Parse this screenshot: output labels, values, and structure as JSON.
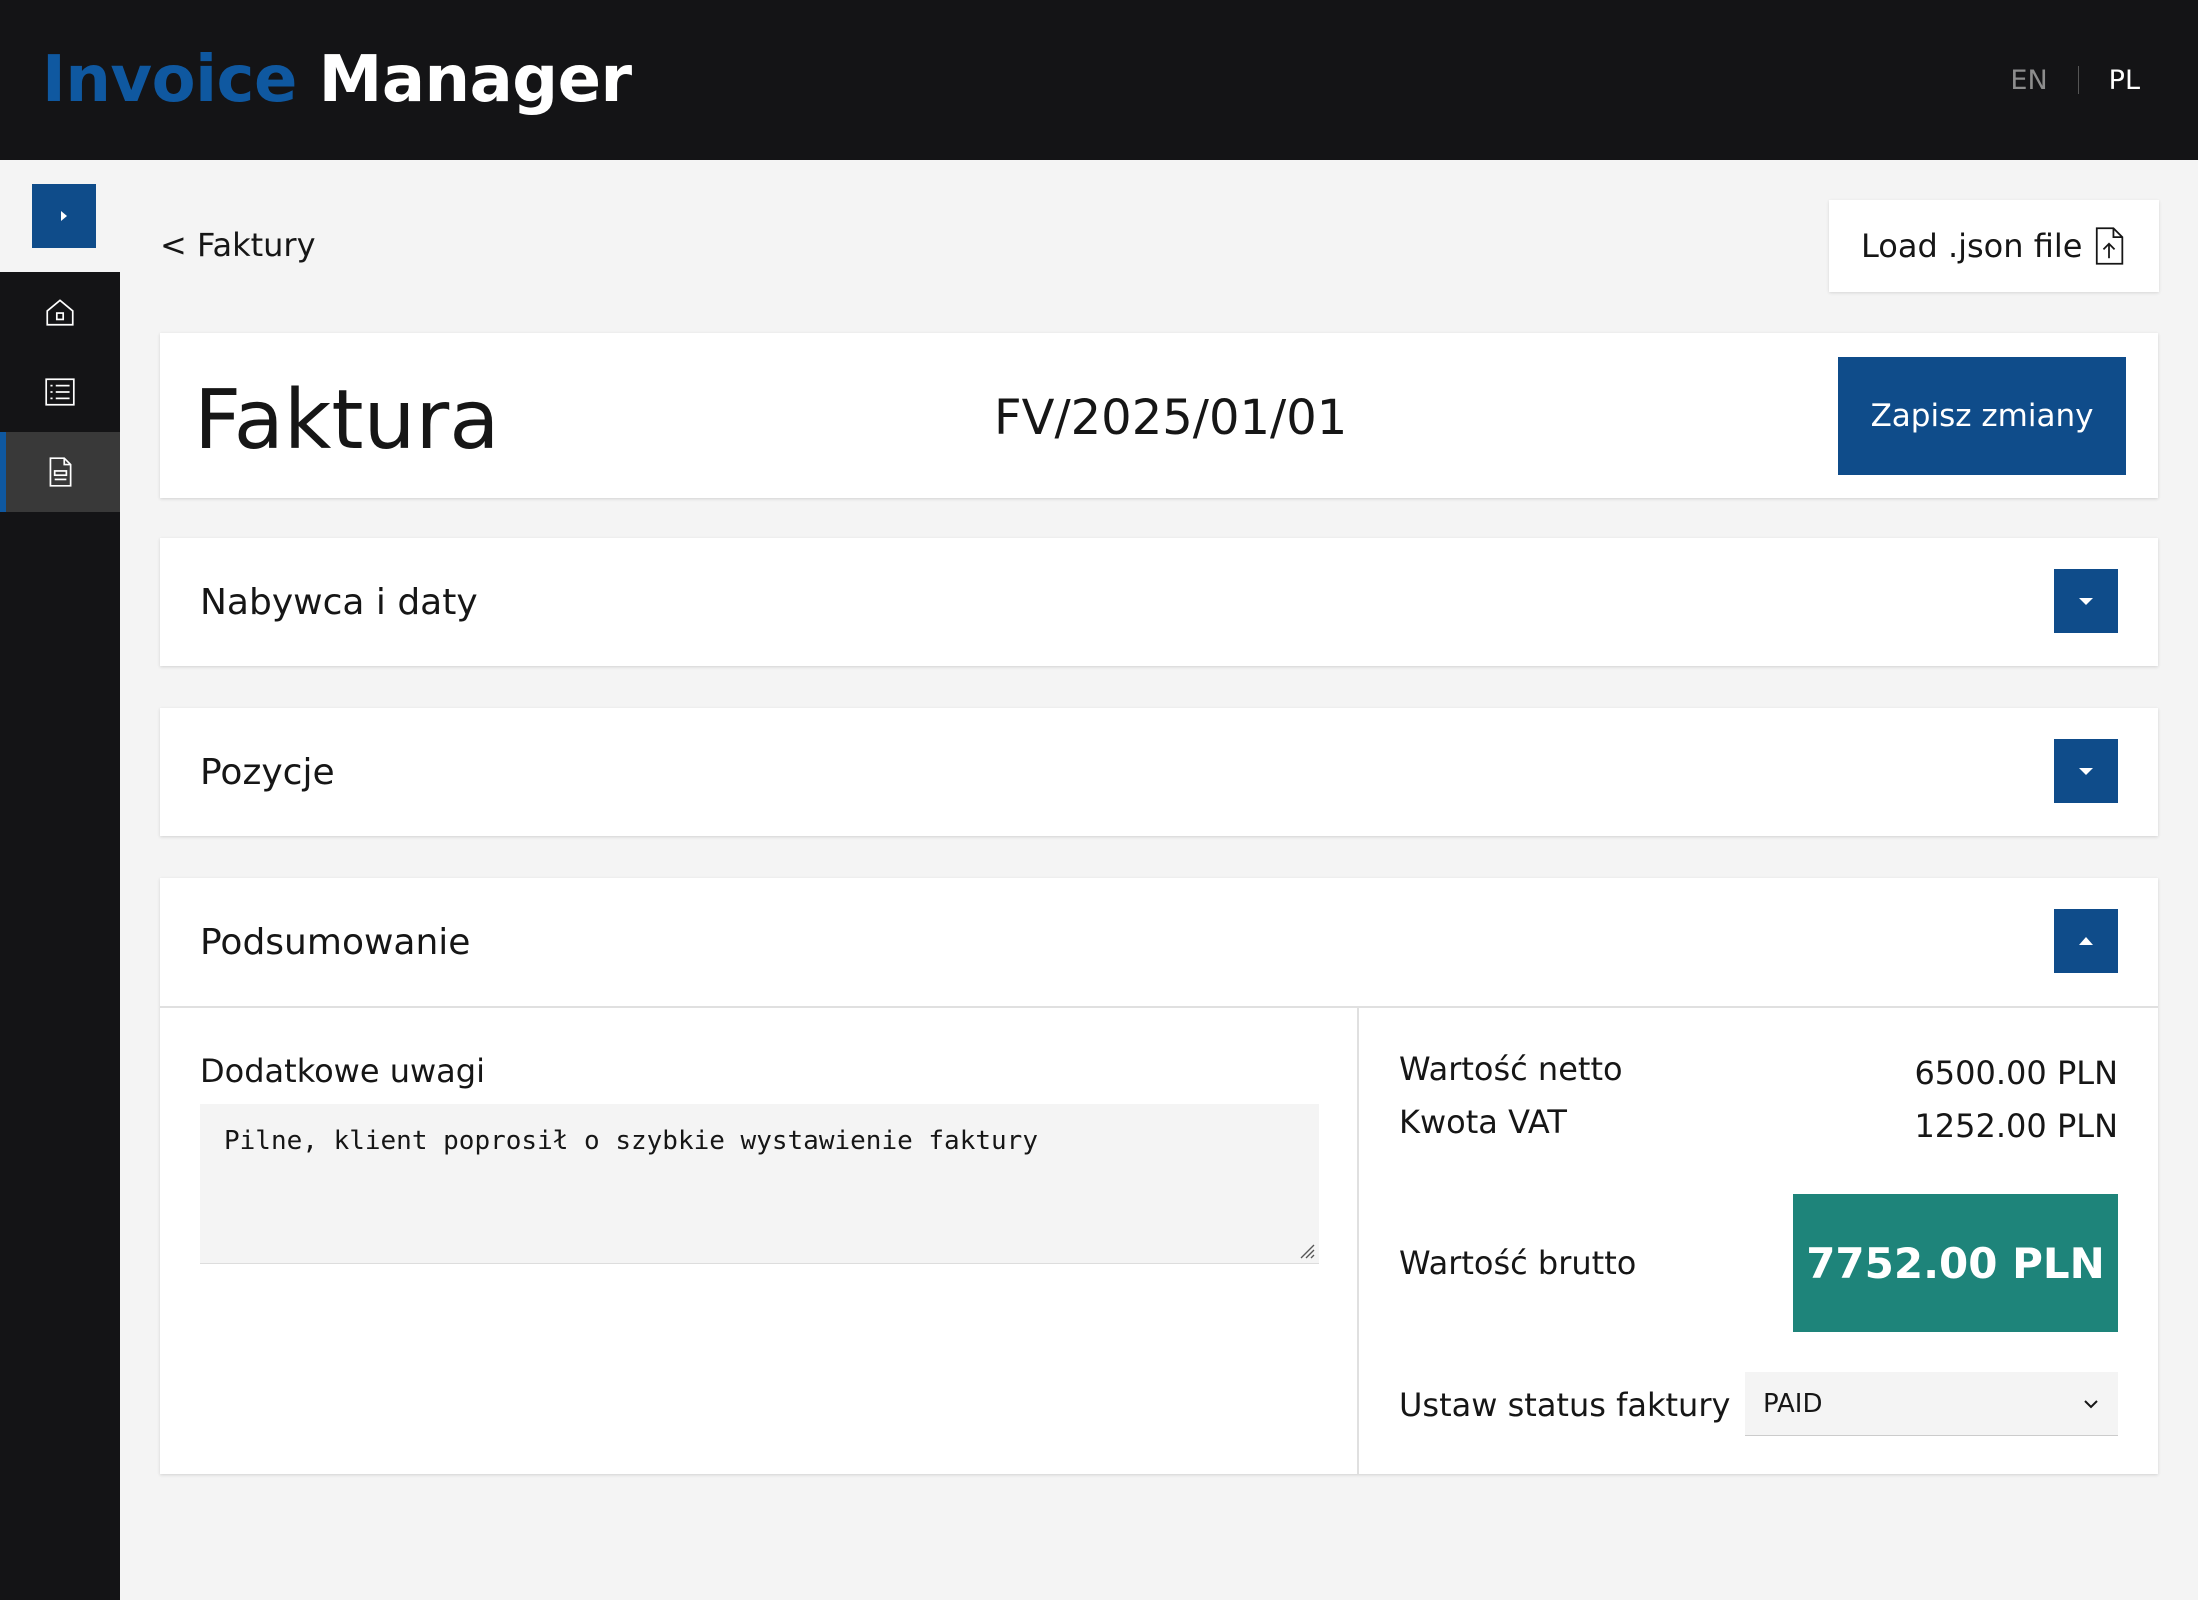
{
  "header": {
    "brand_part1": "Invoice",
    "brand_part2": "Manager",
    "lang_en": "EN",
    "lang_pl": "PL",
    "active_language": "PL"
  },
  "sidebar": {
    "items": [
      {
        "icon": "home-icon"
      },
      {
        "icon": "list-icon"
      },
      {
        "icon": "document-icon",
        "active": true
      }
    ]
  },
  "toolbar": {
    "back_label": "< Faktury",
    "load_label": "Load .json file"
  },
  "invoice": {
    "title": "Faktura",
    "number": "FV/2025/01/01",
    "save_label": "Zapisz zmiany"
  },
  "sections": [
    {
      "title": "Nabywca i daty",
      "expanded": false
    },
    {
      "title": "Pozycje",
      "expanded": false
    },
    {
      "title": "Podsumowanie",
      "expanded": true
    }
  ],
  "summary": {
    "notes_label": "Dodatkowe uwagi",
    "notes_value": "Pilne, klient poprosił o szybkie wystawienie faktury",
    "net_label": "Wartość netto",
    "net_value": "6500.00 PLN",
    "vat_label": "Kwota VAT",
    "vat_value": "1252.00 PLN",
    "gross_label": "Wartość brutto",
    "gross_value": "7752.00 PLN",
    "status_label": "Ustaw status faktury",
    "status_value": "PAID"
  },
  "colors": {
    "accent": "#0f4c8a",
    "brand_blue": "#0f58a0",
    "header_bg": "#141416",
    "gross_bg": "#1e847a"
  }
}
